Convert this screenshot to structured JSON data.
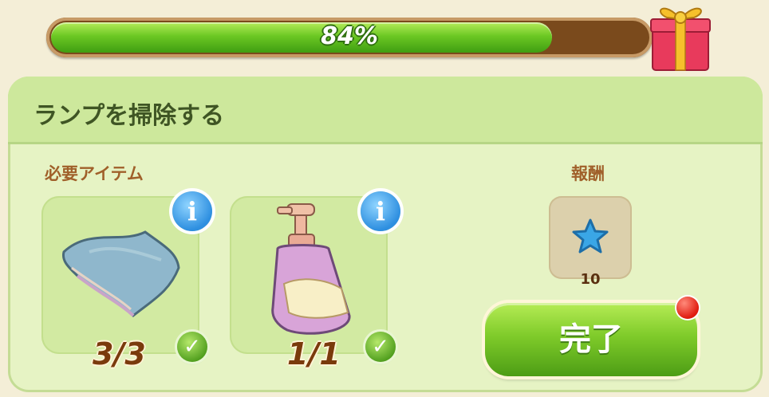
{
  "progress": {
    "percent_label": "84%",
    "value": 0.84
  },
  "quest": {
    "title": "ランプを掃除する"
  },
  "required": {
    "label": "必要アイテム",
    "items": [
      {
        "icon": "towel-icon",
        "count": "3/3",
        "info_label": "i",
        "check": "✓"
      },
      {
        "icon": "soap-bottle-icon",
        "count": "1/1",
        "info_label": "i",
        "check": "✓"
      }
    ]
  },
  "reward": {
    "label": "報酬",
    "icon": "blue-star-icon",
    "amount": "10"
  },
  "complete_button": {
    "label": "完了"
  },
  "colors": {
    "accent_green": "#6cc823",
    "title_brown": "#a0602a",
    "count_brown": "#7a3a0c",
    "info_blue": "#2e8fe0"
  }
}
